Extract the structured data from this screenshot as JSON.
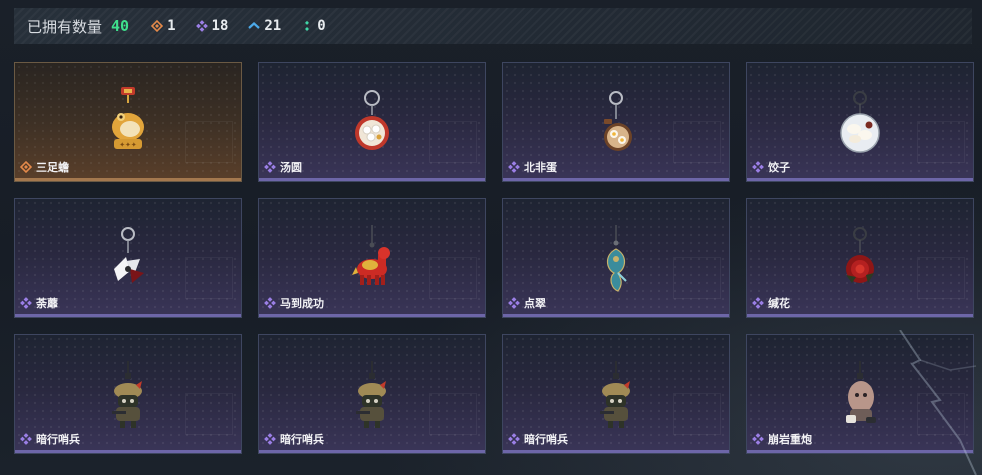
{
  "header": {
    "owned_label": "已拥有数量",
    "owned_count": "40",
    "rarity_counts": [
      {
        "icon": "orange-diamond-icon",
        "color": "#e58a4a",
        "count": "1"
      },
      {
        "icon": "purple-diamond-icon",
        "color": "#9b7fe6",
        "count": "18"
      },
      {
        "icon": "blue-chevron-icon",
        "color": "#4ca9e8",
        "count": "21"
      },
      {
        "icon": "green-dots-icon",
        "color": "#3fd6a6",
        "count": "0"
      }
    ]
  },
  "items": [
    {
      "name": "三足蟾",
      "rarity": "orange",
      "charm": "golden-toad"
    },
    {
      "name": "汤圆",
      "rarity": "purple",
      "charm": "tangyuan-bowl"
    },
    {
      "name": "北非蛋",
      "rarity": "purple",
      "charm": "shakshuka-pan"
    },
    {
      "name": "饺子",
      "rarity": "purple",
      "charm": "dumpling-plate"
    },
    {
      "name": "荼蘼",
      "rarity": "purple",
      "charm": "white-flower"
    },
    {
      "name": "马到成功",
      "rarity": "purple",
      "charm": "red-horse"
    },
    {
      "name": "点翠",
      "rarity": "purple",
      "charm": "phoenix-hairpin"
    },
    {
      "name": "缄花",
      "rarity": "purple",
      "charm": "red-rose"
    },
    {
      "name": "暗行哨兵",
      "rarity": "purple",
      "charm": "sentry-soldier"
    },
    {
      "name": "暗行哨兵",
      "rarity": "purple",
      "charm": "sentry-soldier"
    },
    {
      "name": "暗行哨兵",
      "rarity": "purple",
      "charm": "sentry-soldier"
    },
    {
      "name": "崩岩重炮",
      "rarity": "purple",
      "charm": "rock-gunner"
    }
  ],
  "colors": {
    "accent_green": "#3fe08c",
    "rarity_orange": "#e58a4a",
    "rarity_purple": "#9b7fe6"
  }
}
